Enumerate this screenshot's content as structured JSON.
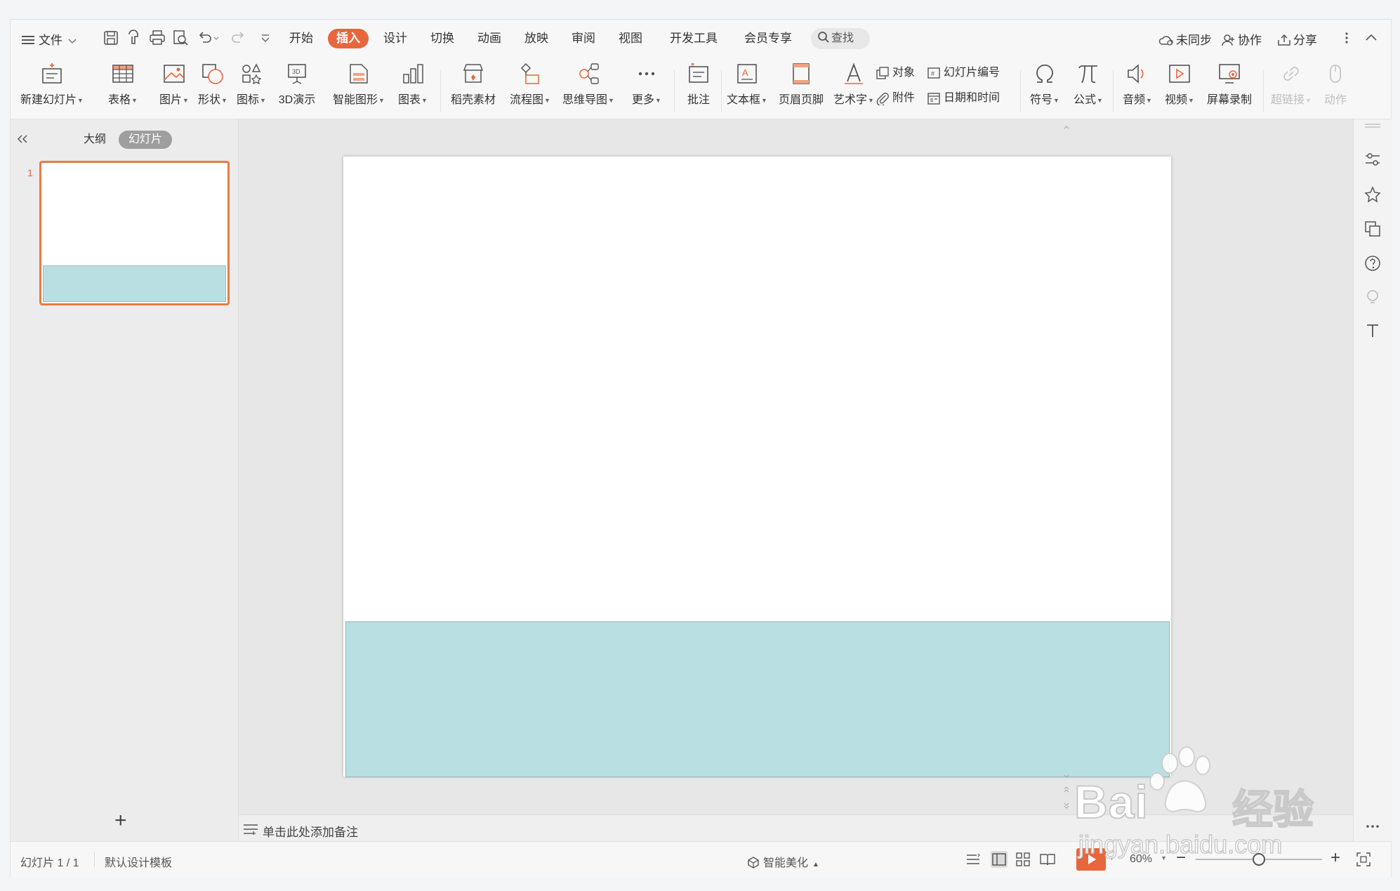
{
  "menubar": {
    "file_label": "文件",
    "tabs": [
      "开始",
      "插入",
      "设计",
      "切换",
      "动画",
      "放映",
      "审阅",
      "视图",
      "开发工具",
      "会员专享"
    ],
    "active_tab": "插入",
    "search_label": "查找",
    "sync_label": "未同步",
    "collab_label": "协作",
    "share_label": "分享"
  },
  "ribbon": {
    "new_slide": "新建幻灯片",
    "table": "表格",
    "picture": "图片",
    "shape": "形状",
    "icons": "图标",
    "demo3d": "3D演示",
    "smartart": "智能图形",
    "chart": "图表",
    "daoke": "稻壳素材",
    "flowchart": "流程图",
    "mindmap": "思维导图",
    "more": "更多",
    "comment": "批注",
    "textbox": "文本框",
    "header_footer": "页眉页脚",
    "wordart": "艺术字",
    "object": "对象",
    "slide_number": "幻灯片编号",
    "attachment": "附件",
    "datetime": "日期和时间",
    "symbol": "符号",
    "formula": "公式",
    "audio": "音频",
    "video": "视频",
    "screen_record": "屏幕录制",
    "hyperlink": "超链接",
    "action": "动作"
  },
  "left_panel": {
    "tab_outline": "大纲",
    "tab_slides": "幻灯片",
    "slide_number": "1",
    "add_label": "+"
  },
  "notes": {
    "placeholder": "单击此处添加备注"
  },
  "statusbar": {
    "slide_info": "幻灯片 1 / 1",
    "template": "默认设计模板",
    "beautify": "智能美化",
    "zoom": "60%",
    "zoom_level": 0.5
  },
  "colors": {
    "accent": "#e8663c",
    "band": "#b9dfe2"
  },
  "watermark": {
    "brand": "Bai",
    "brand_cn": "经验",
    "url": "jingyan.baidu.com"
  }
}
